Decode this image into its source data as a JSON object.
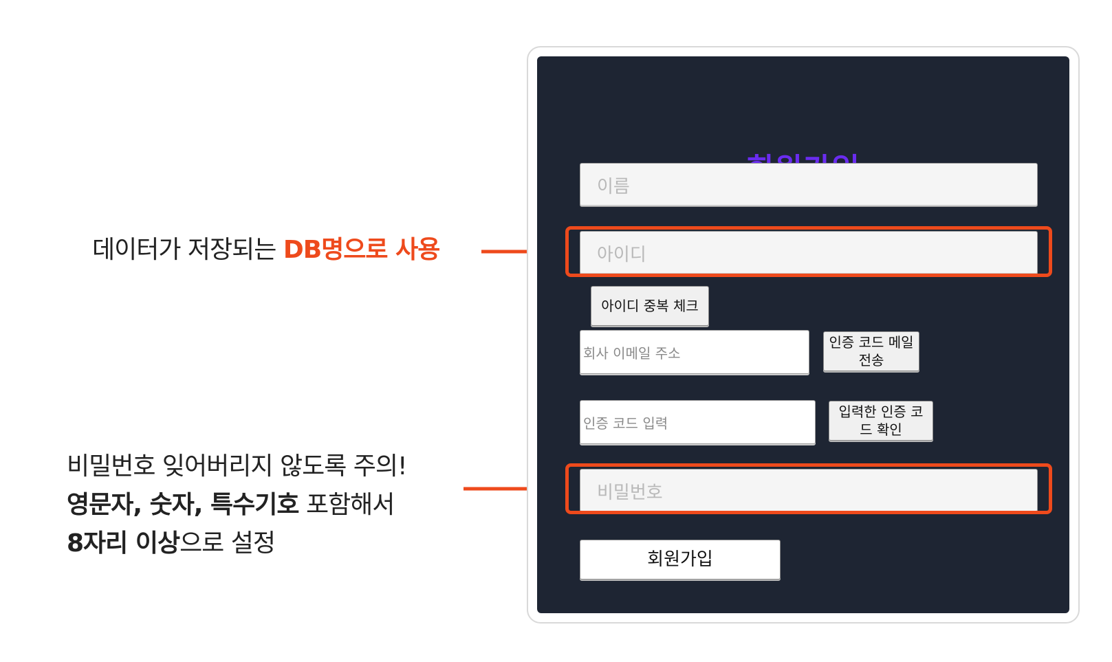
{
  "annotations": {
    "top": {
      "plain": "데이터가 저장되는 ",
      "accent": "DB명으로 사용",
      "accent_color": "#ee4a1c"
    },
    "bottom": {
      "line1": "비밀번호 잊어버리지 않도록 주의!",
      "line2_bold": "영문자, 숫자, 특수기호",
      "line2_rest": " 포함해서",
      "line3_bold": "8자리 이상",
      "line3_rest": "으로 설정"
    }
  },
  "form": {
    "title": "회원가입",
    "title_color": "#6a2cf0",
    "background": "#1e2533",
    "name_placeholder": "이름",
    "id_placeholder": "아이디",
    "id_check_button": "아이디 중복 체크",
    "email_placeholder": "회사 이메일 주소",
    "send_code_button": "인증 코드 메일 전송",
    "code_placeholder": "인증 코드 입력",
    "verify_code_button": "입력한 인증 코드 확인",
    "password_placeholder": "비밀번호",
    "submit_button": "회원가입"
  },
  "colors": {
    "highlight": "#ee4a1c"
  }
}
